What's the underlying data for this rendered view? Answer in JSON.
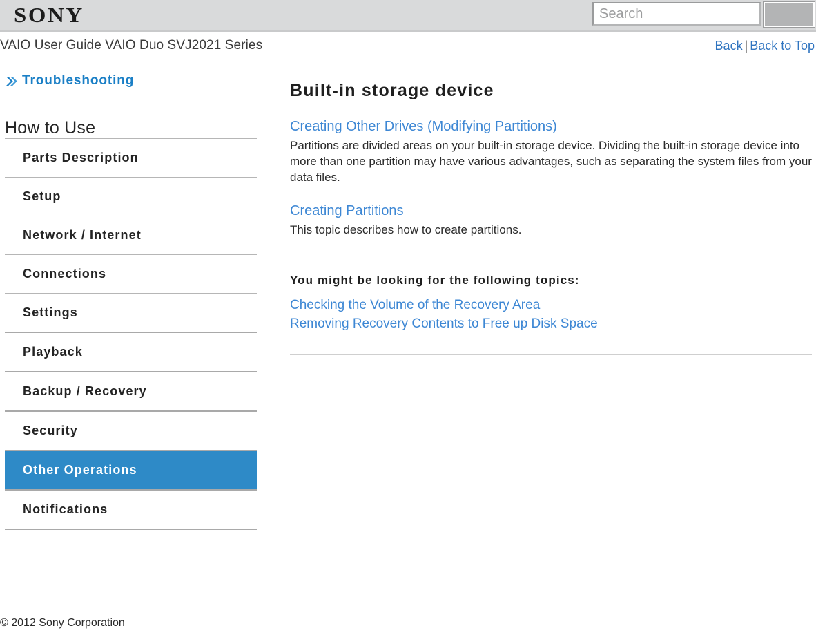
{
  "header": {
    "logo_text": "SONY",
    "search": {
      "placeholder": "Search",
      "value": "",
      "button_label": ""
    }
  },
  "title_bar": {
    "guide_title": "VAIO User Guide VAIO Duo SVJ2021 Series",
    "back_label": "Back",
    "separator": "|",
    "back_to_top_label": "Back to Top"
  },
  "sidebar": {
    "troubleshooting_label": "Troubleshooting",
    "section_heading": "How to Use",
    "items": [
      {
        "label": "Parts Description",
        "active": false
      },
      {
        "label": "Setup",
        "active": false
      },
      {
        "label": "Network / Internet",
        "active": false
      },
      {
        "label": "Connections",
        "active": false
      },
      {
        "label": "Settings",
        "active": false
      },
      {
        "label": "Playback",
        "active": false
      },
      {
        "label": "Backup / Recovery",
        "active": false
      },
      {
        "label": "Security",
        "active": false
      },
      {
        "label": "Other Operations",
        "active": true
      },
      {
        "label": "Notifications",
        "active": false
      }
    ]
  },
  "content": {
    "title": "Built-in storage device",
    "topics": [
      {
        "link": "Creating Other Drives (Modifying Partitions)",
        "description": "Partitions are divided areas on your built-in storage device. Dividing the built-in storage device into more than one partition may have various advantages, such as separating the system files from your data files."
      },
      {
        "link": "Creating Partitions",
        "description": "This topic describes how to create partitions."
      }
    ],
    "related_heading": "You might be looking for the following topics:",
    "related_links": [
      "Checking the Volume of the Recovery Area",
      "Removing Recovery Contents to Free up Disk Space"
    ]
  },
  "footer": {
    "copyright": "© 2012 Sony Corporation"
  },
  "colors": {
    "header_background": "#d9dadb",
    "accent_blue": "#2e8ac7",
    "link_blue": "#3d87d4",
    "troubleshooting_blue": "#1a7fc6",
    "rule_gray": "#b6b6b6"
  }
}
